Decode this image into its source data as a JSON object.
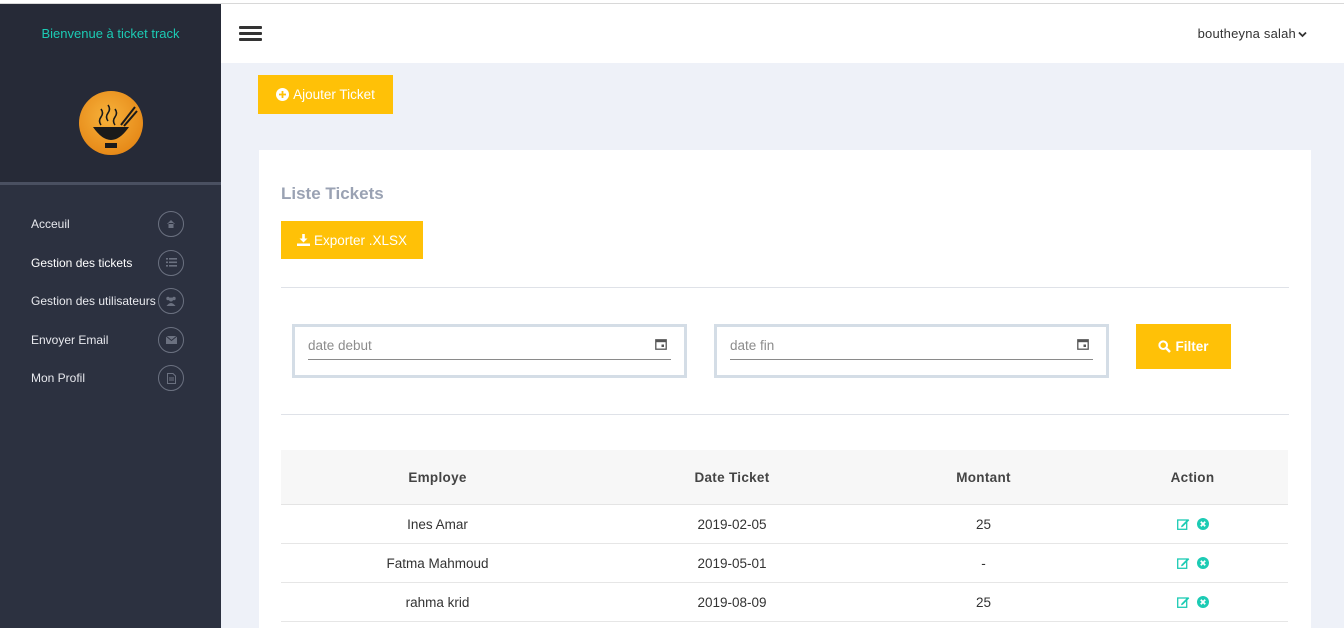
{
  "app": {
    "welcome": "Bienvenue à ticket track",
    "user_name": "boutheyna salah"
  },
  "colors": {
    "accent_teal": "#1ccbb4",
    "button_yellow": "#ffc107",
    "sidebar_bg": "#2c3140"
  },
  "sidebar": {
    "items": [
      {
        "label": "Acceuil",
        "icon": "home-icon"
      },
      {
        "label": "Gestion des tickets",
        "icon": "list-icon"
      },
      {
        "label": "Gestion des utilisateurs",
        "icon": "users-icon"
      },
      {
        "label": "Envoyer Email",
        "icon": "envelope-icon"
      },
      {
        "label": "Mon Profil",
        "icon": "profile-file-icon"
      }
    ],
    "active_index": 1
  },
  "toolbar": {
    "add_ticket_label": "Ajouter Ticket"
  },
  "card": {
    "title": "Liste Tickets",
    "export_label": "Exporter .XLSX"
  },
  "filters": {
    "start_placeholder": "date debut",
    "end_placeholder": "date fin",
    "filter_label": "Filter"
  },
  "table": {
    "columns": [
      "Employe",
      "Date Ticket",
      "Montant",
      "Action"
    ],
    "rows": [
      {
        "employe": "Ines Amar",
        "date": "2019-02-05",
        "montant": "25"
      },
      {
        "employe": "Fatma Mahmoud",
        "date": "2019-05-01",
        "montant": "-"
      },
      {
        "employe": "rahma krid",
        "date": "2019-08-09",
        "montant": "25"
      }
    ],
    "action_icons": [
      "edit-icon",
      "delete-icon"
    ]
  }
}
